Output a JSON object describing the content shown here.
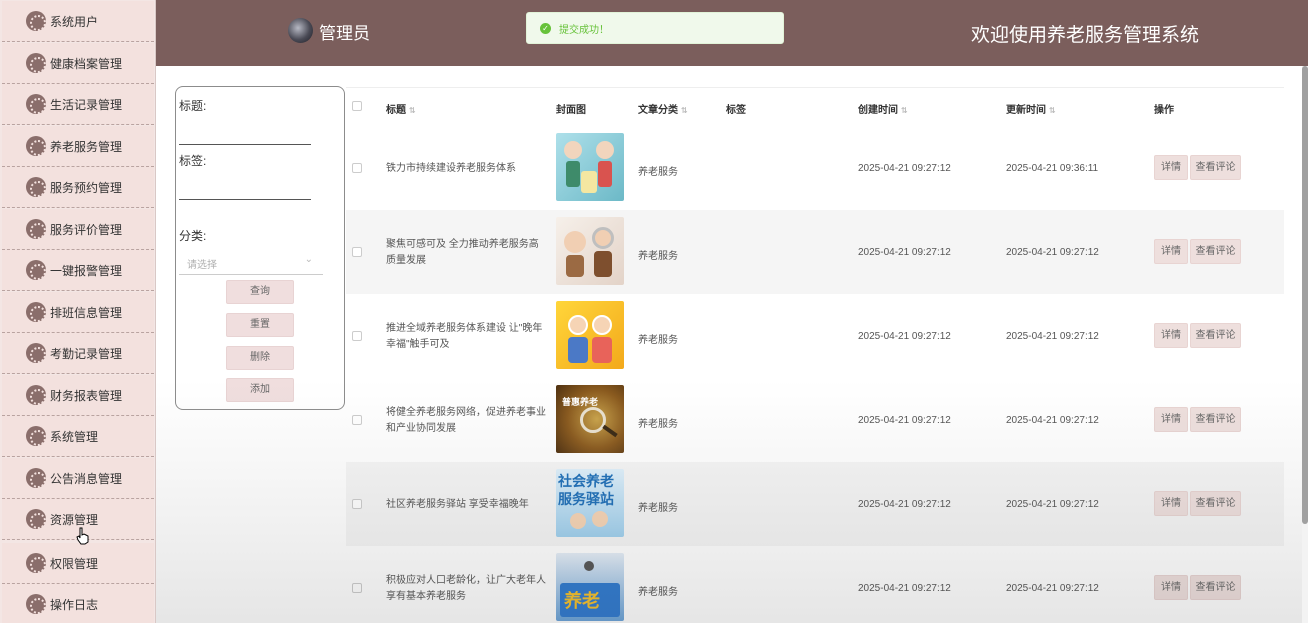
{
  "header": {
    "admin_name": "管理员",
    "welcome": "欢迎使用养老服务管理系统"
  },
  "toast": {
    "message": "提交成功！",
    "type": "success"
  },
  "sidebar": {
    "items": [
      {
        "label": "系统用户"
      },
      {
        "label": "健康档案管理"
      },
      {
        "label": "生活记录管理"
      },
      {
        "label": "养老服务管理"
      },
      {
        "label": "服务预约管理"
      },
      {
        "label": "服务评价管理"
      },
      {
        "label": "一键报警管理"
      },
      {
        "label": "排班信息管理"
      },
      {
        "label": "考勤记录管理"
      },
      {
        "label": "财务报表管理"
      },
      {
        "label": "系统管理"
      },
      {
        "label": "公告消息管理"
      },
      {
        "label": "资源管理"
      },
      {
        "label": "权限管理"
      },
      {
        "label": "操作日志"
      }
    ]
  },
  "search": {
    "title_label": "标题:",
    "tags_label": "标签:",
    "category_label": "分类:",
    "category_placeholder": "请选择",
    "buttons": {
      "query": "查询",
      "reset": "重置",
      "delete": "删除",
      "add": "添加"
    }
  },
  "table": {
    "headers": {
      "title": "标题",
      "cover": "封面图",
      "category": "文章分类",
      "tags": "标签",
      "created": "创建时间",
      "updated": "更新时间",
      "actions": "操作"
    },
    "actions": {
      "detail": "详情",
      "comments": "查看评论"
    },
    "rows": [
      {
        "title": "铁力市持续建设养老服务体系",
        "category": "养老服务",
        "tags": "",
        "created": "2025-04-21 09:27:12",
        "updated": "2025-04-21 09:36:11"
      },
      {
        "title": "聚焦可感可及 全力推动养老服务高质量发展",
        "category": "养老服务",
        "tags": "",
        "created": "2025-04-21 09:27:12",
        "updated": "2025-04-21 09:27:12"
      },
      {
        "title": "推进全域养老服务体系建设 让\"晚年幸福\"触手可及",
        "category": "养老服务",
        "tags": "",
        "created": "2025-04-21 09:27:12",
        "updated": "2025-04-21 09:27:12"
      },
      {
        "title": "将健全养老服务网络，促进养老事业和产业协同发展",
        "category": "养老服务",
        "tags": "",
        "created": "2025-04-21 09:27:12",
        "updated": "2025-04-21 09:27:12"
      },
      {
        "title": "社区养老服务驿站 享受幸福晚年",
        "category": "养老服务",
        "tags": "",
        "created": "2025-04-21 09:27:12",
        "updated": "2025-04-21 09:27:12"
      },
      {
        "title": "积极应对人口老龄化，让广大老年人享有基本养老服务",
        "category": "养老服务",
        "tags": "",
        "created": "2025-04-21 09:27:12",
        "updated": "2025-04-21 09:27:12"
      }
    ]
  },
  "covers": {
    "row4_text": "普惠养老",
    "row5_text_line1": "社会养老",
    "row5_text_line2": "服务驿站",
    "row6_text": "养老"
  },
  "colors": {
    "header": "#7b5e5c",
    "sidebar": "#f3e1de",
    "button": "#eedfdd",
    "success": "#67c23a"
  }
}
